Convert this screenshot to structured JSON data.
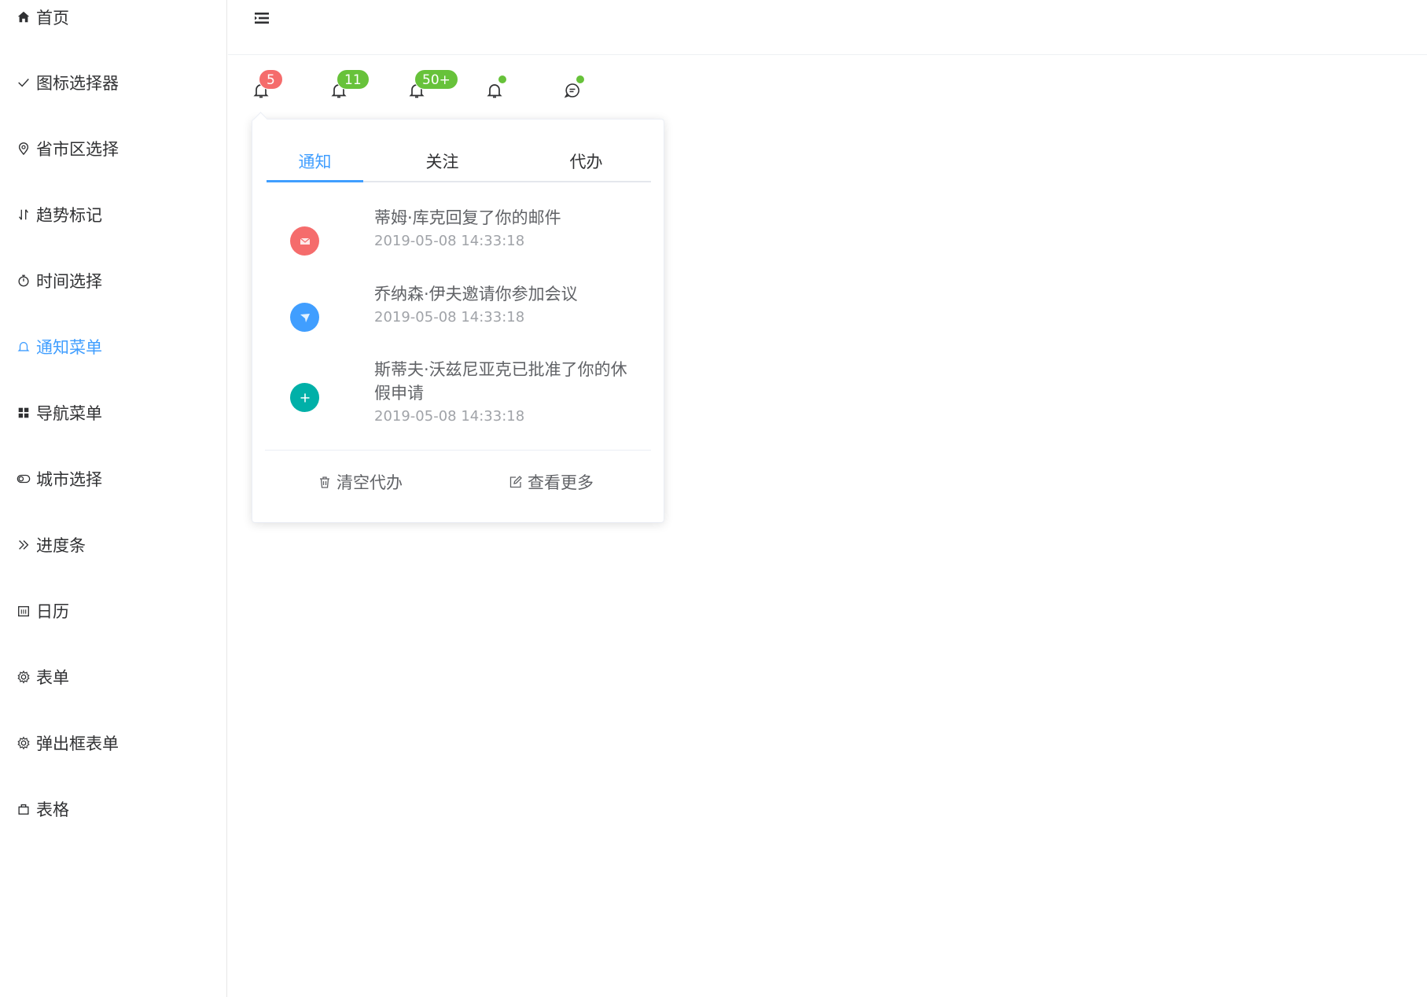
{
  "sidebar": {
    "items": [
      {
        "label": "首页",
        "icon": "home-icon"
      },
      {
        "label": "图标选择器",
        "icon": "check-icon"
      },
      {
        "label": "省市区选择",
        "icon": "location-icon"
      },
      {
        "label": "趋势标记",
        "icon": "sort-icon"
      },
      {
        "label": "时间选择",
        "icon": "stopwatch-icon"
      },
      {
        "label": "通知菜单",
        "icon": "bell-icon",
        "active": true
      },
      {
        "label": "导航菜单",
        "icon": "grid-icon"
      },
      {
        "label": "城市选择",
        "icon": "toggle-icon"
      },
      {
        "label": "进度条",
        "icon": "double-chevron-right-icon"
      },
      {
        "label": "日历",
        "icon": "calendar-icon"
      },
      {
        "label": "表单",
        "icon": "gear-icon"
      },
      {
        "label": "弹出框表单",
        "icon": "gear-icon"
      },
      {
        "label": "表格",
        "icon": "bag-icon"
      }
    ]
  },
  "header": {
    "menu_toggle_icon": "hamburger-icon"
  },
  "notifications": {
    "badges": [
      {
        "value": "5",
        "color": "#f56c6c"
      },
      {
        "value": "11",
        "color": "#67c23a"
      },
      {
        "value": "50+",
        "color": "#67c23a"
      }
    ],
    "dot_color": "#67c23a"
  },
  "popover": {
    "tabs": [
      "通知",
      "关注",
      "代办"
    ],
    "active_tab": "通知",
    "items": [
      {
        "title": "蒂姆·库克回复了你的邮件",
        "time": "2019-05-08 14:33:18",
        "icon": "mail-icon",
        "color": "#f56c6c"
      },
      {
        "title": "乔纳森·伊夫邀请你参加会议",
        "time": "2019-05-08 14:33:18",
        "icon": "plane-icon",
        "color": "#409eff"
      },
      {
        "title": "斯蒂夫·沃兹尼亚克已批准了你的休假申请",
        "time": "2019-05-08 14:33:18",
        "icon": "plus-icon",
        "color": "#00b0a8"
      }
    ],
    "footer": {
      "clear_label": "清空代办",
      "more_label": "查看更多"
    }
  },
  "colors": {
    "accent": "#409eff"
  }
}
